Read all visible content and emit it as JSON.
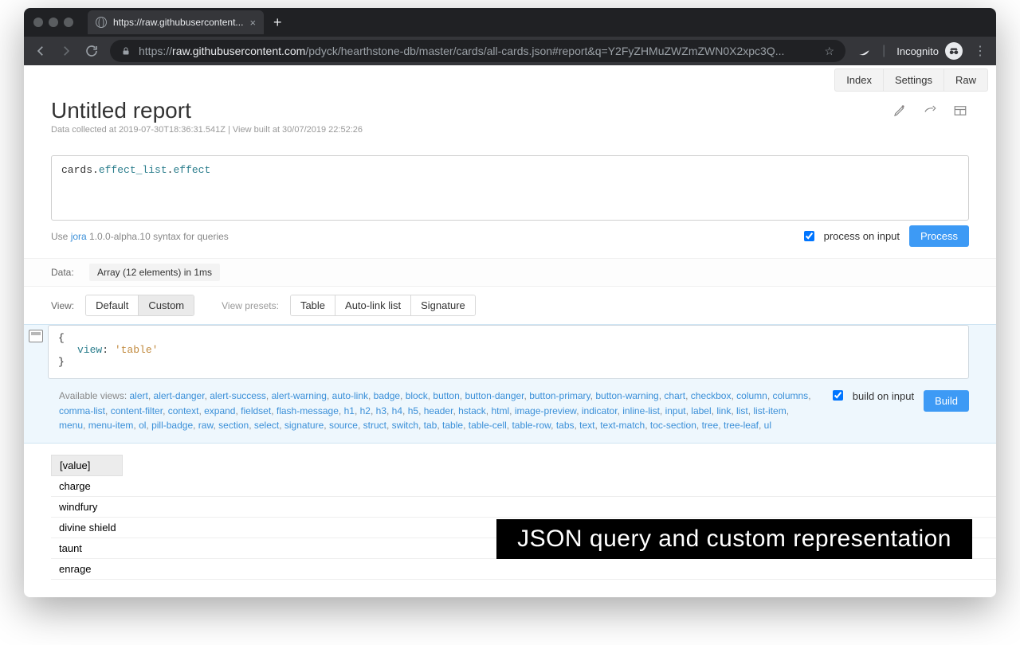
{
  "browser": {
    "tab_title": "https://raw.githubusercontent...",
    "url_host": "raw.githubusercontent.com",
    "url_path": "/pdyck/hearthstone-db/master/cards/all-cards.json#report&q=Y2FyZHMuZWZmZWN0X2xpc3Q...",
    "incognito_label": "Incognito"
  },
  "top_tabs": {
    "index": "Index",
    "settings": "Settings",
    "raw": "Raw"
  },
  "header": {
    "title": "Untitled report",
    "subline": "Data collected at 2019-07-30T18:36:31.541Z | View built at 30/07/2019 22:52:26"
  },
  "query": {
    "tokens": [
      {
        "t": "cards",
        "c": "tok-base"
      },
      {
        "t": ".",
        "c": "tok-base"
      },
      {
        "t": "effect_list",
        "c": "tok-prop"
      },
      {
        "t": ".",
        "c": "tok-base"
      },
      {
        "t": "effect",
        "c": "tok-prop"
      }
    ],
    "hint_prefix": "Use ",
    "hint_link": "jora",
    "hint_suffix": " 1.0.0-alpha.10 syntax for queries",
    "process_label": "process on input",
    "process_btn": "Process"
  },
  "data_row": {
    "label": "Data:",
    "summary": "Array (12 elements) in 1ms"
  },
  "view_row": {
    "label": "View:",
    "default": "Default",
    "custom": "Custom",
    "presets_label": "View presets:",
    "presets": [
      "Table",
      "Auto-link list",
      "Signature"
    ]
  },
  "custom_code": {
    "open": "{",
    "key": "view",
    "colon": ": ",
    "value": "'table'",
    "close": "}"
  },
  "views_footer": {
    "label": "Available views: ",
    "items": [
      "alert",
      "alert-danger",
      "alert-success",
      "alert-warning",
      "auto-link",
      "badge",
      "block",
      "button",
      "button-danger",
      "button-primary",
      "button-warning",
      "chart",
      "checkbox",
      "column",
      "columns",
      "comma-list",
      "content-filter",
      "context",
      "expand",
      "fieldset",
      "flash-message",
      "h1",
      "h2",
      "h3",
      "h4",
      "h5",
      "header",
      "hstack",
      "html",
      "image-preview",
      "indicator",
      "inline-list",
      "input",
      "label",
      "link",
      "list",
      "list-item",
      "menu",
      "menu-item",
      "ol",
      "pill-badge",
      "raw",
      "section",
      "select",
      "signature",
      "source",
      "struct",
      "switch",
      "tab",
      "table",
      "table-cell",
      "table-row",
      "tabs",
      "text",
      "text-match",
      "toc-section",
      "tree",
      "tree-leaf",
      "ul"
    ],
    "build_label": "build on input",
    "build_btn": "Build"
  },
  "result": {
    "header": "[value]",
    "rows": [
      "charge",
      "windfury",
      "divine shield",
      "taunt",
      "enrage"
    ]
  },
  "caption": "JSON query and custom representation"
}
